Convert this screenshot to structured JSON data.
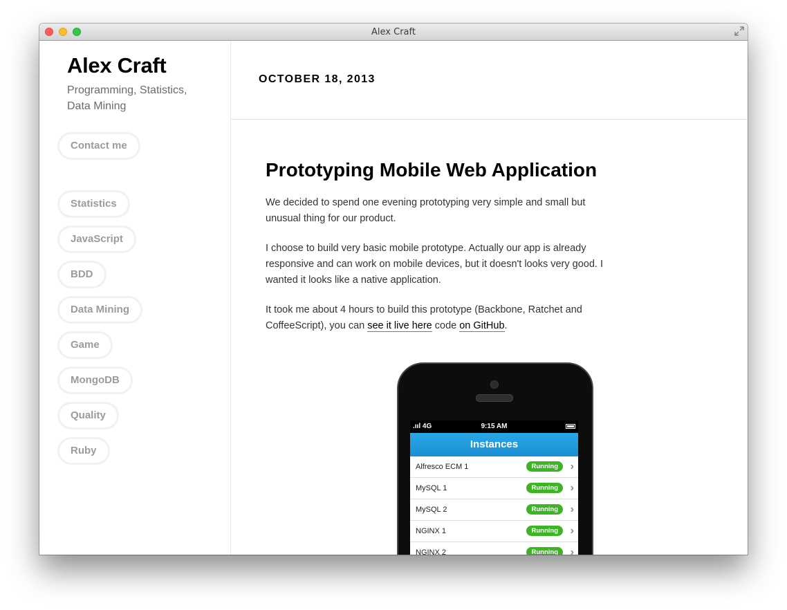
{
  "window": {
    "title": "Alex Craft"
  },
  "sidebar": {
    "site_title": "Alex Craft",
    "tagline": "Programming, Statistics, Data Mining",
    "contact_label": "Contact me",
    "tags": [
      "Statistics",
      "JavaScript",
      "BDD",
      "Data Mining",
      "Game",
      "MongoDB",
      "Quality",
      "Ruby"
    ]
  },
  "post": {
    "date": "OCTOBER 18, 2013",
    "title": "Prototyping Mobile Web Application",
    "p1": "We decided to spend one evening prototyping very simple and small but unusual thing for our product.",
    "p2": "I choose to build very basic mobile prototype. Actually our app is already responsive and can work on mobile devices, but it doesn't looks very good. I wanted it looks like a native application.",
    "p3_start": "It took me about 4 hours to build this prototype (Backbone, Ratchet and CoffeeScript), you can ",
    "p3_link1": "see it live here",
    "p3_mid": " code ",
    "p3_link2": "on GitHub",
    "p3_end": "."
  },
  "phone": {
    "signal": ".ııl 4G",
    "time": "9:15 AM",
    "header": "Instances",
    "rows": [
      {
        "name": "Alfresco ECM 1",
        "status": "Running"
      },
      {
        "name": "MySQL 1",
        "status": "Running"
      },
      {
        "name": "MySQL 2",
        "status": "Running"
      },
      {
        "name": "NGINX 1",
        "status": "Running"
      },
      {
        "name": "NGINX 2",
        "status": "Running"
      }
    ]
  },
  "colors": {
    "accent_blue": "#1a8fd3",
    "status_green": "#3eb325",
    "pill_border": "#f1f1f1"
  }
}
